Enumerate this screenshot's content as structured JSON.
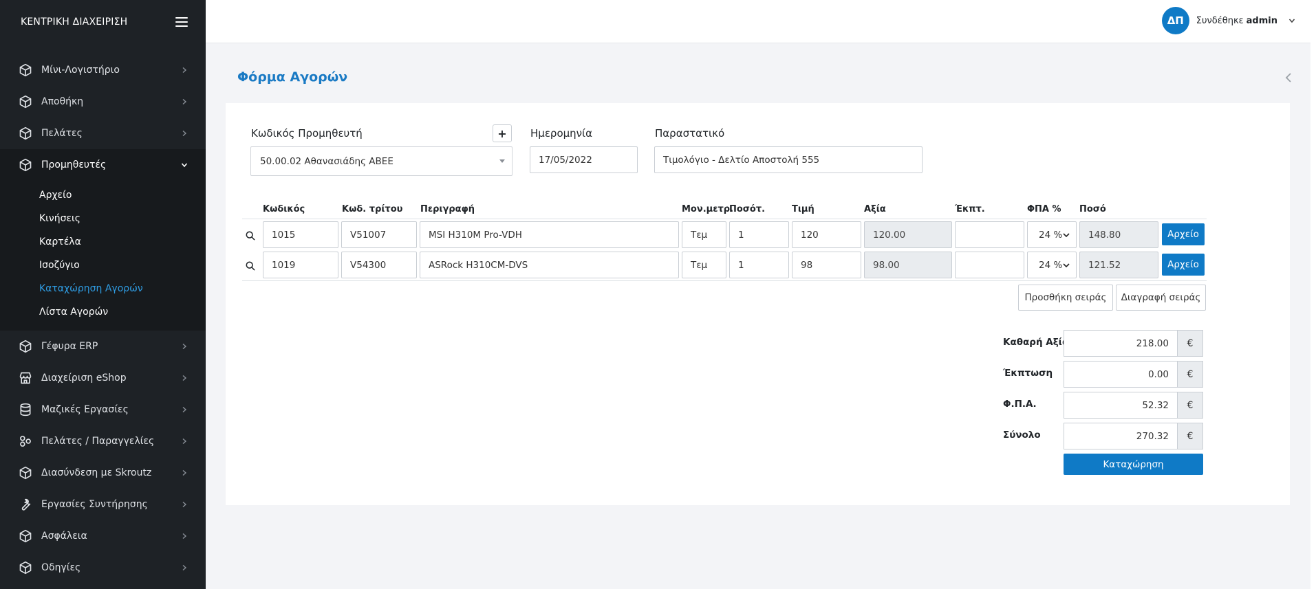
{
  "sidebar": {
    "brand": "ΚΕΝΤΡΙΚΗ ΔΙΑΧΕΙΡΙΣΗ",
    "items": [
      {
        "label": "Μίνι-Λογιστήριο",
        "icon": "cube-icon"
      },
      {
        "label": "Αποθήκη",
        "icon": "cube-icon"
      },
      {
        "label": "Πελάτες",
        "icon": "cube-icon"
      },
      {
        "label": "Προμηθευτές",
        "icon": "cube-icon"
      },
      {
        "label": "Γέφυρα ERP",
        "icon": "cube-icon"
      },
      {
        "label": "Διαχείριση eShop",
        "icon": "store-icon"
      },
      {
        "label": "Μαζικές Εργασίες",
        "icon": "database-icon"
      },
      {
        "label": "Πελάτες / Παραγγελίες",
        "icon": "hub-icon"
      },
      {
        "label": "Διασύνδεση με Skroutz",
        "icon": "cube-icon"
      },
      {
        "label": "Εργασίες Συντήρησης",
        "icon": "wrench-icon"
      },
      {
        "label": "Ασφάλεια",
        "icon": "cube-icon"
      },
      {
        "label": "Οδηγίες",
        "icon": "cube-icon"
      }
    ],
    "submenu": [
      "Αρχείο",
      "Κινήσεις",
      "Καρτέλα",
      "Ισοζύγιο",
      "Καταχώρηση Αγορών",
      "Λίστα Αγορών"
    ],
    "active_sub": "Καταχώρηση Αγορών"
  },
  "topbar": {
    "avatar_initials": "ΔΠ",
    "logged_in_text": "Συνδέθηκε",
    "username": "admin"
  },
  "page": {
    "title": "Φόρμα Αγορών"
  },
  "form": {
    "supplier_label": "Κωδικός Προμηθευτή",
    "supplier_value": "50.00.02 Αθανασιάδης ΑΒΕΕ",
    "add_supplier": "+",
    "date_label": "Ημερομηνία",
    "date_value": "17/05/2022",
    "doc_label": "Παραστατικό",
    "doc_value": "Τιμολόγιο - Δελτίο Αποστολή 555"
  },
  "table": {
    "headers": {
      "code": "Κωδικός",
      "third_code": "Κωδ. τρίτου",
      "description": "Περιγραφή",
      "unit": "Μον.μετρ.",
      "qty": "Ποσότ.",
      "price": "Τιμή",
      "value": "Αξία",
      "discount": "Έκπτ.",
      "vat": "ΦΠΑ %",
      "amount": "Ποσό"
    },
    "rows": [
      {
        "code": "1015",
        "third_code": "V51007",
        "description": "MSI H310M Pro-VDH",
        "unit": "Τεμ",
        "qty": "1",
        "price": "120",
        "value": "120.00",
        "discount": "",
        "vat": "24 %",
        "amount": "148.80",
        "file_btn": "Αρχείο"
      },
      {
        "code": "1019",
        "third_code": "V54300",
        "description": "ASRock H310CM-DVS",
        "unit": "Τεμ",
        "qty": "1",
        "price": "98",
        "value": "98.00",
        "discount": "",
        "vat": "24 %",
        "amount": "121.52",
        "file_btn": "Αρχείο"
      }
    ],
    "add_row": "Προσθήκη σειράς",
    "delete_row": "Διαγραφή σειράς"
  },
  "totals": {
    "net_label": "Καθαρή Αξία",
    "net_value": "218.00",
    "discount_label": "Έκπτωση",
    "discount_value": "0.00",
    "vat_label": "Φ.Π.Α.",
    "vat_value": "52.32",
    "total_label": "Σύνολο",
    "total_value": "270.32",
    "currency": "€",
    "submit": "Καταχώρηση"
  },
  "colors": {
    "accent": "#0f7ac6",
    "title": "#1a7ac4",
    "sidebar_bg": "#1e2226",
    "active_link": "#2f9de4"
  }
}
